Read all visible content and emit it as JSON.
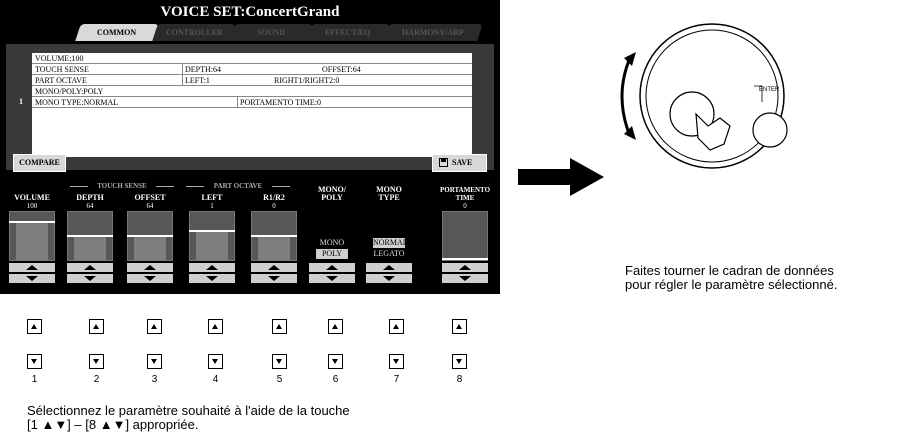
{
  "screen": {
    "title": "VOICE SET:ConcertGrand",
    "tabs": [
      "COMMON",
      "CONTROLLER",
      "SOUND",
      "EFFECT/EQ",
      "HARMONY/ARP"
    ],
    "active_tab": "COMMON"
  },
  "table": {
    "part_number": "1",
    "rows": {
      "volume": "VOLUME:100",
      "touch_sense": "TOUCH SENSE",
      "depth": "DEPTH:64",
      "offset": "OFFSET:64",
      "part_octave": "PART OCTAVE",
      "left": "LEFT:1",
      "right": "RIGHT1/RIGHT2:0",
      "mono_poly": "MONO/POLY:POLY",
      "mono_type": "MONO TYPE:NORMAL",
      "portamento": "PORTAMENTO TIME:0"
    }
  },
  "buttons": {
    "compare": "COMPARE",
    "save": "SAVE"
  },
  "groups": {
    "touch_sense": "TOUCH SENSE",
    "part_octave": "PART OCTAVE"
  },
  "params": [
    {
      "label": "VOLUME",
      "value": "100",
      "level": 0.79
    },
    {
      "label": "DEPTH",
      "value": "64",
      "level": 0.5
    },
    {
      "label": "OFFSET",
      "value": "64",
      "level": 0.5
    },
    {
      "label": "LEFT",
      "value": "1",
      "level": 0.6
    },
    {
      "label": "R1/R2",
      "value": "0",
      "level": 0.5
    },
    {
      "label": "MONO/ POLY",
      "options": [
        "MONO",
        "POLY"
      ],
      "selected": "POLY"
    },
    {
      "label": "MONO TYPE",
      "options": [
        "NORMAL",
        "LEGATO"
      ],
      "selected": "NORMAL"
    },
    {
      "label": "PORTAMENTO TIME",
      "value": "0",
      "level": 0.0
    }
  ],
  "hardware_buttons": [
    "1",
    "2",
    "3",
    "4",
    "5",
    "6",
    "7",
    "8"
  ],
  "captions": {
    "select": [
      "Sélectionnez le paramètre souhaité à l'aide de la touche",
      "[1 ▲▼] – [8 ▲▼] appropriée."
    ],
    "dial": [
      "Faites tourner le cadran de données",
      "pour régler le paramètre sélectionné."
    ],
    "enter": "ENTER"
  }
}
